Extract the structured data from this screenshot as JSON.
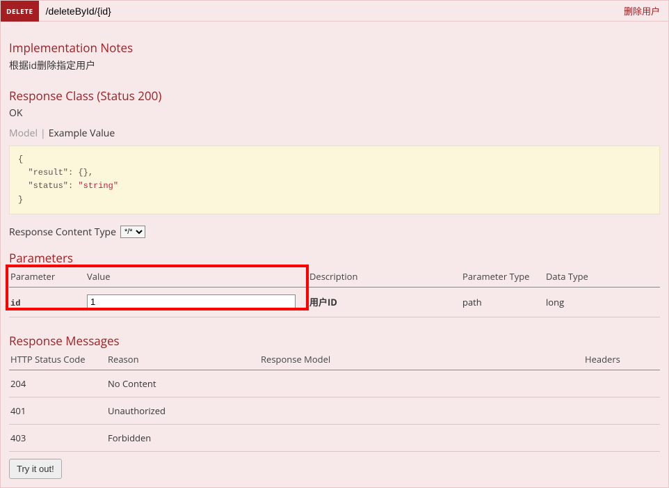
{
  "operation": {
    "method": "DELETE",
    "path": "/deleteById/{id}",
    "summary": "删除用户"
  },
  "sections": {
    "impl_notes": "Implementation Notes",
    "impl_notes_text": "根据id删除指定用户",
    "response_class": "Response Class (Status 200)",
    "response_ok": "OK",
    "tab_model": "Model",
    "tab_example": "Example Value",
    "response_content_type": "Response Content Type",
    "content_type_value": "*/*",
    "parameters": "Parameters",
    "response_messages": "Response Messages"
  },
  "example_json": {
    "line1": "{",
    "line2_key": "  \"result\"",
    "line2_rest": ": {},",
    "line3_key": "  \"status\"",
    "line3_colon": ": ",
    "line3_val": "\"string\"",
    "line4": "}"
  },
  "params_table": {
    "headers": {
      "parameter": "Parameter",
      "value": "Value",
      "description": "Description",
      "ptype": "Parameter Type",
      "dtype": "Data Type"
    },
    "rows": [
      {
        "name": "id",
        "value": "1",
        "description": "用户ID",
        "ptype": "path",
        "dtype": "long"
      }
    ]
  },
  "responses_table": {
    "headers": {
      "code": "HTTP Status Code",
      "reason": "Reason",
      "model": "Response Model",
      "headers": "Headers"
    },
    "rows": [
      {
        "code": "204",
        "reason": "No Content",
        "model": "",
        "headers": ""
      },
      {
        "code": "401",
        "reason": "Unauthorized",
        "model": "",
        "headers": ""
      },
      {
        "code": "403",
        "reason": "Forbidden",
        "model": "",
        "headers": ""
      }
    ]
  },
  "try_button": "Try it out!"
}
